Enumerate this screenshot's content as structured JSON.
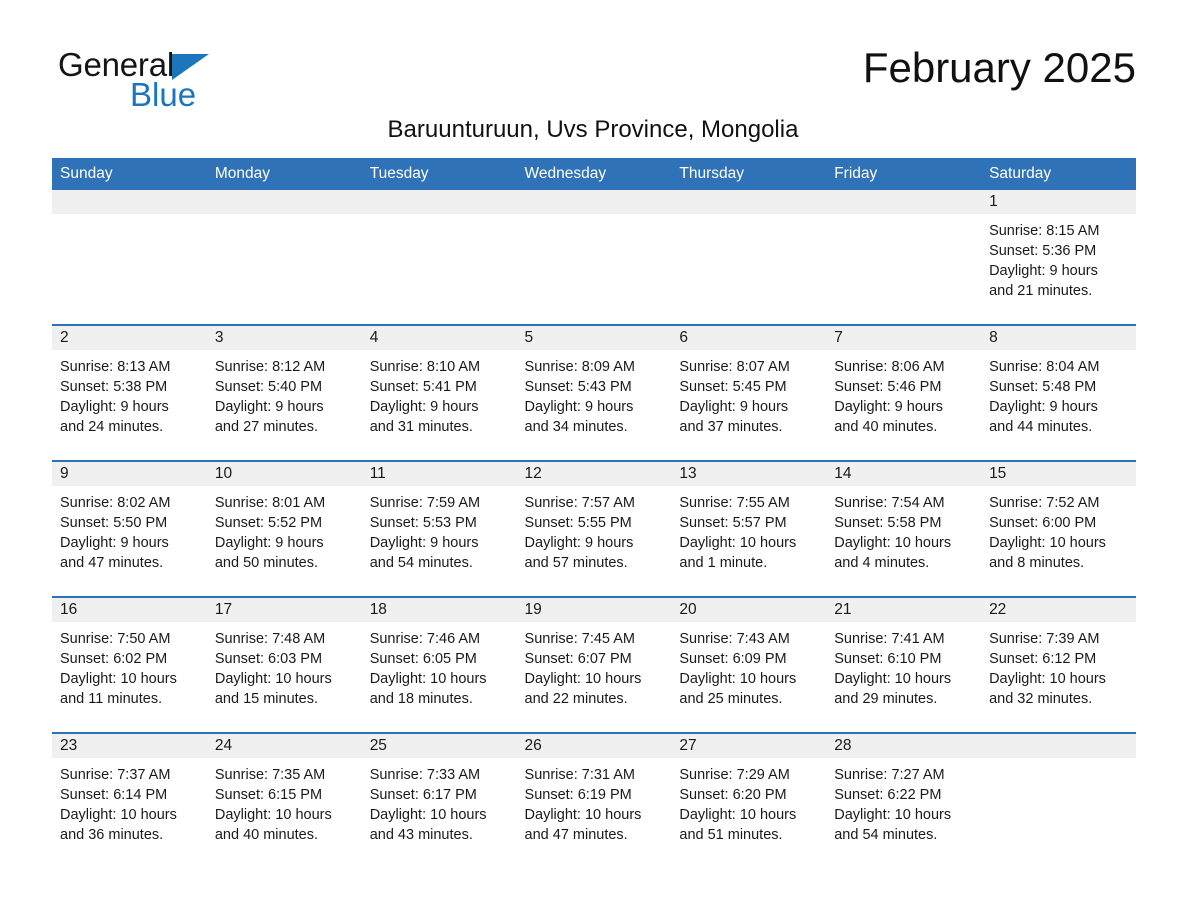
{
  "brand": {
    "name_part1": "General",
    "name_part2": "Blue",
    "logo_icon": "blue-triangle"
  },
  "header": {
    "title": "February 2025",
    "subtitle": "Baruunturuun, Uvs Province, Mongolia"
  },
  "colors": {
    "header_blue": "#2f72b8",
    "logo_blue": "#1b76bc",
    "daynum_band": "#f0f0f0",
    "row_divider": "#2f72b8"
  },
  "weekday_headers": [
    "Sunday",
    "Monday",
    "Tuesday",
    "Wednesday",
    "Thursday",
    "Friday",
    "Saturday"
  ],
  "weeks": [
    [
      {
        "day": "",
        "lines": []
      },
      {
        "day": "",
        "lines": []
      },
      {
        "day": "",
        "lines": []
      },
      {
        "day": "",
        "lines": []
      },
      {
        "day": "",
        "lines": []
      },
      {
        "day": "",
        "lines": []
      },
      {
        "day": "1",
        "lines": [
          "Sunrise: 8:15 AM",
          "Sunset: 5:36 PM",
          "Daylight: 9 hours",
          "and 21 minutes."
        ]
      }
    ],
    [
      {
        "day": "2",
        "lines": [
          "Sunrise: 8:13 AM",
          "Sunset: 5:38 PM",
          "Daylight: 9 hours",
          "and 24 minutes."
        ]
      },
      {
        "day": "3",
        "lines": [
          "Sunrise: 8:12 AM",
          "Sunset: 5:40 PM",
          "Daylight: 9 hours",
          "and 27 minutes."
        ]
      },
      {
        "day": "4",
        "lines": [
          "Sunrise: 8:10 AM",
          "Sunset: 5:41 PM",
          "Daylight: 9 hours",
          "and 31 minutes."
        ]
      },
      {
        "day": "5",
        "lines": [
          "Sunrise: 8:09 AM",
          "Sunset: 5:43 PM",
          "Daylight: 9 hours",
          "and 34 minutes."
        ]
      },
      {
        "day": "6",
        "lines": [
          "Sunrise: 8:07 AM",
          "Sunset: 5:45 PM",
          "Daylight: 9 hours",
          "and 37 minutes."
        ]
      },
      {
        "day": "7",
        "lines": [
          "Sunrise: 8:06 AM",
          "Sunset: 5:46 PM",
          "Daylight: 9 hours",
          "and 40 minutes."
        ]
      },
      {
        "day": "8",
        "lines": [
          "Sunrise: 8:04 AM",
          "Sunset: 5:48 PM",
          "Daylight: 9 hours",
          "and 44 minutes."
        ]
      }
    ],
    [
      {
        "day": "9",
        "lines": [
          "Sunrise: 8:02 AM",
          "Sunset: 5:50 PM",
          "Daylight: 9 hours",
          "and 47 minutes."
        ]
      },
      {
        "day": "10",
        "lines": [
          "Sunrise: 8:01 AM",
          "Sunset: 5:52 PM",
          "Daylight: 9 hours",
          "and 50 minutes."
        ]
      },
      {
        "day": "11",
        "lines": [
          "Sunrise: 7:59 AM",
          "Sunset: 5:53 PM",
          "Daylight: 9 hours",
          "and 54 minutes."
        ]
      },
      {
        "day": "12",
        "lines": [
          "Sunrise: 7:57 AM",
          "Sunset: 5:55 PM",
          "Daylight: 9 hours",
          "and 57 minutes."
        ]
      },
      {
        "day": "13",
        "lines": [
          "Sunrise: 7:55 AM",
          "Sunset: 5:57 PM",
          "Daylight: 10 hours",
          "and 1 minute."
        ]
      },
      {
        "day": "14",
        "lines": [
          "Sunrise: 7:54 AM",
          "Sunset: 5:58 PM",
          "Daylight: 10 hours",
          "and 4 minutes."
        ]
      },
      {
        "day": "15",
        "lines": [
          "Sunrise: 7:52 AM",
          "Sunset: 6:00 PM",
          "Daylight: 10 hours",
          "and 8 minutes."
        ]
      }
    ],
    [
      {
        "day": "16",
        "lines": [
          "Sunrise: 7:50 AM",
          "Sunset: 6:02 PM",
          "Daylight: 10 hours",
          "and 11 minutes."
        ]
      },
      {
        "day": "17",
        "lines": [
          "Sunrise: 7:48 AM",
          "Sunset: 6:03 PM",
          "Daylight: 10 hours",
          "and 15 minutes."
        ]
      },
      {
        "day": "18",
        "lines": [
          "Sunrise: 7:46 AM",
          "Sunset: 6:05 PM",
          "Daylight: 10 hours",
          "and 18 minutes."
        ]
      },
      {
        "day": "19",
        "lines": [
          "Sunrise: 7:45 AM",
          "Sunset: 6:07 PM",
          "Daylight: 10 hours",
          "and 22 minutes."
        ]
      },
      {
        "day": "20",
        "lines": [
          "Sunrise: 7:43 AM",
          "Sunset: 6:09 PM",
          "Daylight: 10 hours",
          "and 25 minutes."
        ]
      },
      {
        "day": "21",
        "lines": [
          "Sunrise: 7:41 AM",
          "Sunset: 6:10 PM",
          "Daylight: 10 hours",
          "and 29 minutes."
        ]
      },
      {
        "day": "22",
        "lines": [
          "Sunrise: 7:39 AM",
          "Sunset: 6:12 PM",
          "Daylight: 10 hours",
          "and 32 minutes."
        ]
      }
    ],
    [
      {
        "day": "23",
        "lines": [
          "Sunrise: 7:37 AM",
          "Sunset: 6:14 PM",
          "Daylight: 10 hours",
          "and 36 minutes."
        ]
      },
      {
        "day": "24",
        "lines": [
          "Sunrise: 7:35 AM",
          "Sunset: 6:15 PM",
          "Daylight: 10 hours",
          "and 40 minutes."
        ]
      },
      {
        "day": "25",
        "lines": [
          "Sunrise: 7:33 AM",
          "Sunset: 6:17 PM",
          "Daylight: 10 hours",
          "and 43 minutes."
        ]
      },
      {
        "day": "26",
        "lines": [
          "Sunrise: 7:31 AM",
          "Sunset: 6:19 PM",
          "Daylight: 10 hours",
          "and 47 minutes."
        ]
      },
      {
        "day": "27",
        "lines": [
          "Sunrise: 7:29 AM",
          "Sunset: 6:20 PM",
          "Daylight: 10 hours",
          "and 51 minutes."
        ]
      },
      {
        "day": "28",
        "lines": [
          "Sunrise: 7:27 AM",
          "Sunset: 6:22 PM",
          "Daylight: 10 hours",
          "and 54 minutes."
        ]
      },
      {
        "day": "",
        "lines": []
      }
    ]
  ]
}
